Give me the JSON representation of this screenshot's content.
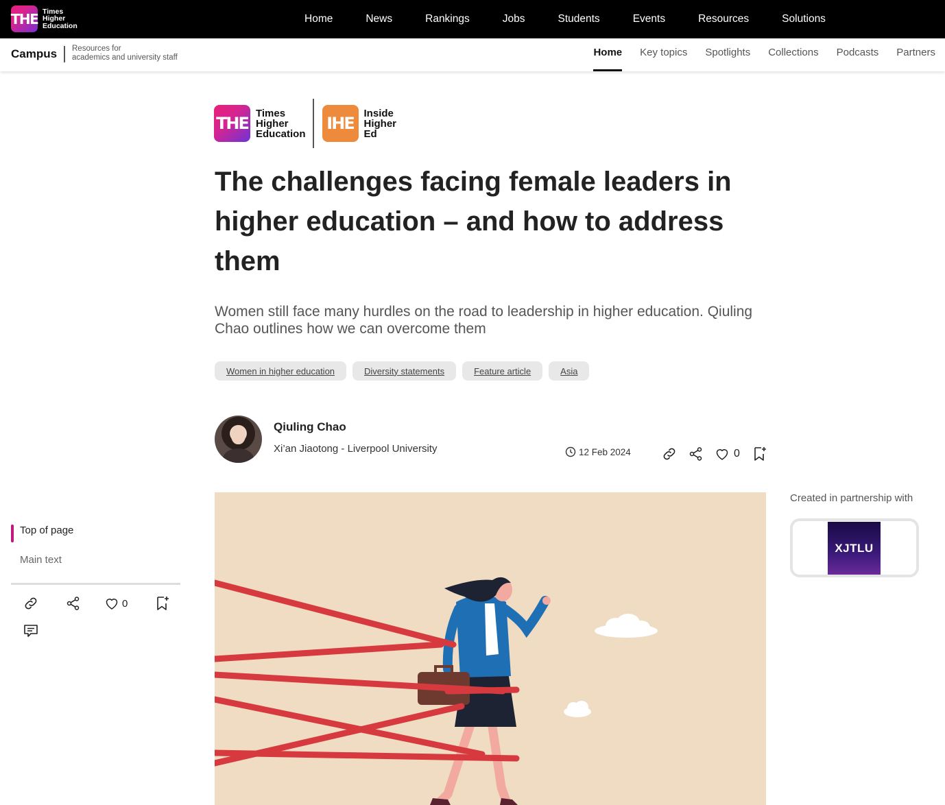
{
  "topbar": {
    "logo": {
      "mark": "THE",
      "words": [
        "Times",
        "Higher",
        "Education"
      ]
    },
    "nav": [
      "Home",
      "News",
      "Rankings",
      "Jobs",
      "Students",
      "Events",
      "Resources",
      "Solutions"
    ]
  },
  "subbar": {
    "brand": "Campus",
    "tagline_line1": "Resources for",
    "tagline_line2": "academics and university staff",
    "nav": [
      "Home",
      "Key topics",
      "Spotlights",
      "Collections",
      "Podcasts",
      "Partners"
    ],
    "active": "Home"
  },
  "partner_logos": {
    "the": {
      "mark": "THE",
      "words": [
        "Times",
        "Higher",
        "Education"
      ]
    },
    "ihe": {
      "mark": "IHE",
      "words": [
        "Inside",
        "Higher",
        "Ed"
      ]
    }
  },
  "article": {
    "headline": "The challenges facing female leaders in higher education – and how to address them",
    "standfirst": "Women still face many hurdles on the road to leadership in higher education. Qiuling Chao outlines how we can overcome them",
    "tags": [
      "Women in higher education",
      "Diversity statements",
      "Feature article",
      "Asia"
    ],
    "author": {
      "name": "Qiuling Chao",
      "institution": "Xi’an Jiaotong - Liverpool University"
    },
    "date": "12 Feb 2024",
    "likes": "0"
  },
  "partnership": {
    "label": "Created in partnership with",
    "partner_logo": "XJTLU"
  },
  "toc": {
    "items": [
      "Top of page",
      "Main text"
    ],
    "likes": "0"
  },
  "colors": {
    "accent": "#c2187d",
    "hero_bg": "#efdcc2",
    "ribbon": "#d63a3f",
    "jacket": "#1f6fb5"
  },
  "icons": [
    "clock-icon",
    "link-icon",
    "share-icon",
    "heart-icon",
    "bookmark-icon",
    "comment-icon"
  ]
}
